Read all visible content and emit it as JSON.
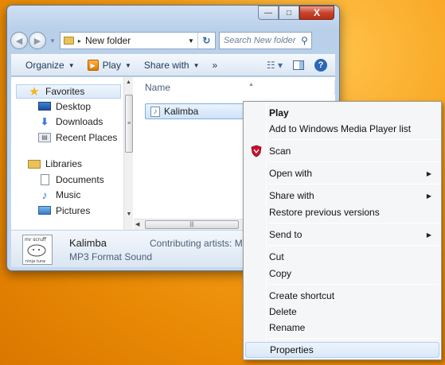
{
  "window": {
    "caption_buttons": {
      "minimize": "—",
      "maximize": "□",
      "close": "X"
    },
    "address": {
      "path_separator": "▸",
      "folder": "New folder"
    },
    "search": {
      "placeholder": "Search New folder"
    },
    "toolbar": {
      "organize": "Organize",
      "play": "Play",
      "share_with": "Share with",
      "more": "»"
    },
    "nav_pane": {
      "favorites": "Favorites",
      "favorite_items": [
        "Desktop",
        "Downloads",
        "Recent Places"
      ],
      "libraries": "Libraries",
      "library_items": [
        "Documents",
        "Music",
        "Pictures"
      ]
    },
    "file_list": {
      "column_name": "Name",
      "files": [
        "Kalimba"
      ]
    },
    "details": {
      "file_name": "Kalimba",
      "file_type": "MP3 Format Sound",
      "property_label": "Contributing artists:",
      "property_value": "Mr",
      "thumbnail_text": [
        "mr scruff",
        "ninja tune"
      ]
    }
  },
  "context_menu": {
    "items": [
      {
        "label": "Play",
        "bold": true
      },
      {
        "label": "Add to Windows Media Player list"
      },
      {
        "label": "Scan",
        "icon": "shield-icon"
      },
      {
        "label": "Open with",
        "submenu": true
      },
      {
        "label": "Share with",
        "submenu": true
      },
      {
        "label": "Restore previous versions"
      },
      {
        "label": "Send to",
        "submenu": true
      },
      {
        "label": "Cut"
      },
      {
        "label": "Copy"
      },
      {
        "label": "Create shortcut"
      },
      {
        "label": "Delete"
      },
      {
        "label": "Rename"
      },
      {
        "label": "Properties",
        "highlighted": true
      }
    ]
  },
  "colors": {
    "desktop_background": "#f39a12",
    "menu_highlight": "#dae8f8",
    "selection": "#cfe3f8"
  }
}
